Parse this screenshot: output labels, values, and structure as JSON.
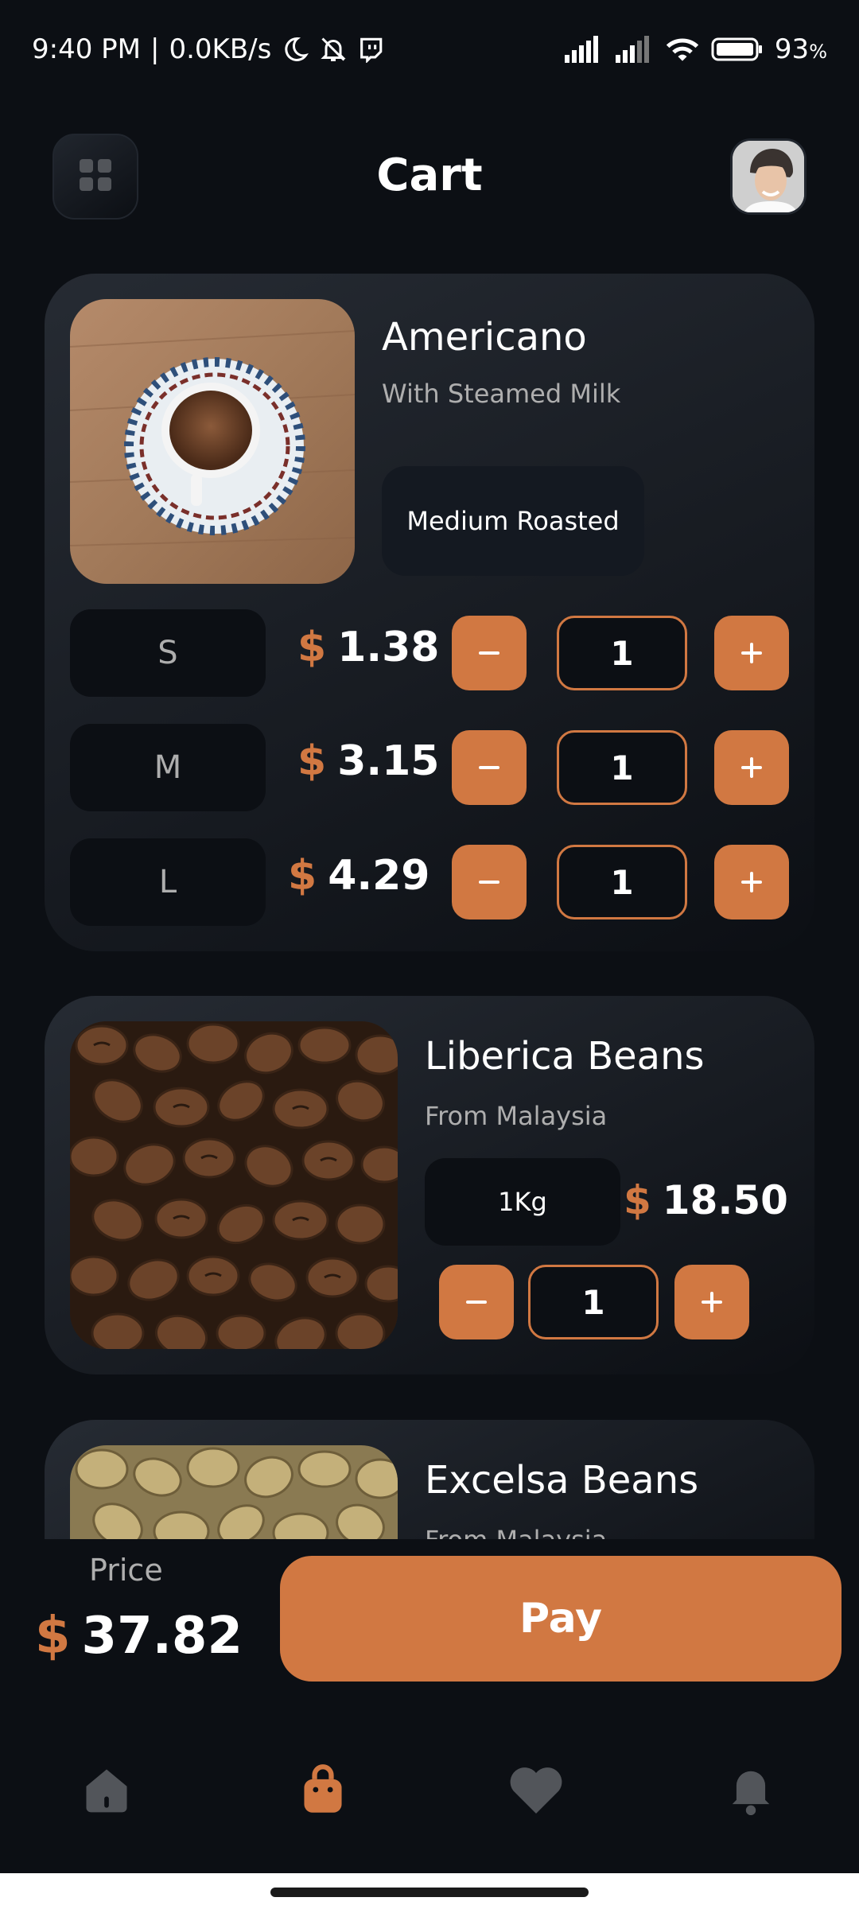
{
  "status_bar": {
    "time": "9:40 PM",
    "network_speed": "0.0KB/s",
    "battery": "93"
  },
  "header": {
    "title": "Cart"
  },
  "cart": {
    "items": [
      {
        "name": "Americano",
        "subtitle": "With Steamed Milk",
        "roast": "Medium Roasted",
        "sizes": [
          {
            "size": "S",
            "currency": "$",
            "price": "1.38",
            "quantity": "1"
          },
          {
            "size": "M",
            "currency": "$",
            "price": "3.15",
            "quantity": "1"
          },
          {
            "size": "L",
            "currency": "$",
            "price": "4.29",
            "quantity": "1"
          }
        ]
      },
      {
        "name": "Liberica Beans",
        "subtitle": "From Malaysia",
        "sizes": [
          {
            "size": "1Kg",
            "currency": "$",
            "price": "18.50",
            "quantity": "1"
          }
        ]
      },
      {
        "name": "Excelsa Beans",
        "subtitle": "From Malaysia"
      }
    ]
  },
  "footer": {
    "price_label": "Price",
    "currency": "$",
    "total": "37.82",
    "pay_label": "Pay"
  },
  "icons": {
    "accent": "#d17842",
    "nav": [
      "home-icon",
      "bag-icon",
      "heart-icon",
      "bell-icon"
    ]
  },
  "colors": {
    "accent": "#d17842",
    "background": "#0c0f14",
    "inactive_icon": "#52555a"
  }
}
